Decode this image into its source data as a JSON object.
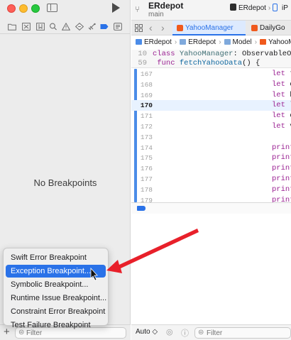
{
  "navigator": {
    "empty_message": "No Breakpoints",
    "filter_placeholder": "Filter",
    "add_label": "+",
    "tabs": [
      "folder-icon",
      "source-control-icon",
      "bookmark-icon",
      "find-icon",
      "issues-icon",
      "tests-icon",
      "debug-icon",
      "breakpoints-icon",
      "reports-icon"
    ]
  },
  "menu": {
    "items": [
      {
        "label": "Swift Error Breakpoint"
      },
      {
        "label": "Exception Breakpoint..."
      },
      {
        "label": "Symbolic Breakpoint..."
      },
      {
        "label": "Runtime Issue Breakpoint..."
      },
      {
        "label": "Constraint Error Breakpoint"
      },
      {
        "label": "Test Failure Breakpoint"
      }
    ],
    "selected_index": 1
  },
  "window": {
    "project_name": "ERdepot",
    "branch": "main",
    "scheme": "ERdepot",
    "scheme_sep": "›",
    "device_label": "iP"
  },
  "tabs": {
    "active": "YahooManager",
    "inactive": "DailyGo"
  },
  "jumpbar": {
    "items": [
      "ERdepot",
      "ERdepot",
      "Model",
      "YahooM"
    ]
  },
  "code": {
    "sticky": [
      {
        "line": "10",
        "kw": "class",
        "name": "YahooManager",
        "rest": ": ObservableObj"
      },
      {
        "line": "59",
        "kw": "func",
        "name": "fetchYahooData",
        "rest": "() {"
      }
    ],
    "lines": [
      {
        "n": "167",
        "t": "let t"
      },
      {
        "n": "168",
        "t": "let c"
      },
      {
        "n": "169",
        "t": "let h"
      },
      {
        "n": "170",
        "t": "let l"
      },
      {
        "n": "171",
        "t": "let c"
      },
      {
        "n": "172",
        "t": "let v"
      },
      {
        "n": "173",
        "t": ""
      },
      {
        "n": "174",
        "t": "print"
      },
      {
        "n": "175",
        "t": "print"
      },
      {
        "n": "176",
        "t": "print"
      },
      {
        "n": "177",
        "t": "print"
      },
      {
        "n": "178",
        "t": "print"
      },
      {
        "n": "179",
        "t": "print"
      },
      {
        "n": "180",
        "t": "print"
      }
    ],
    "current_line": "170"
  },
  "console": {
    "auto_label": "Auto ◇",
    "filter_placeholder": "Filter"
  },
  "colors": {
    "accent": "#2a72e8",
    "arrow": "#e8202a",
    "keyword": "#9b2393",
    "function": "#0f68a0"
  }
}
